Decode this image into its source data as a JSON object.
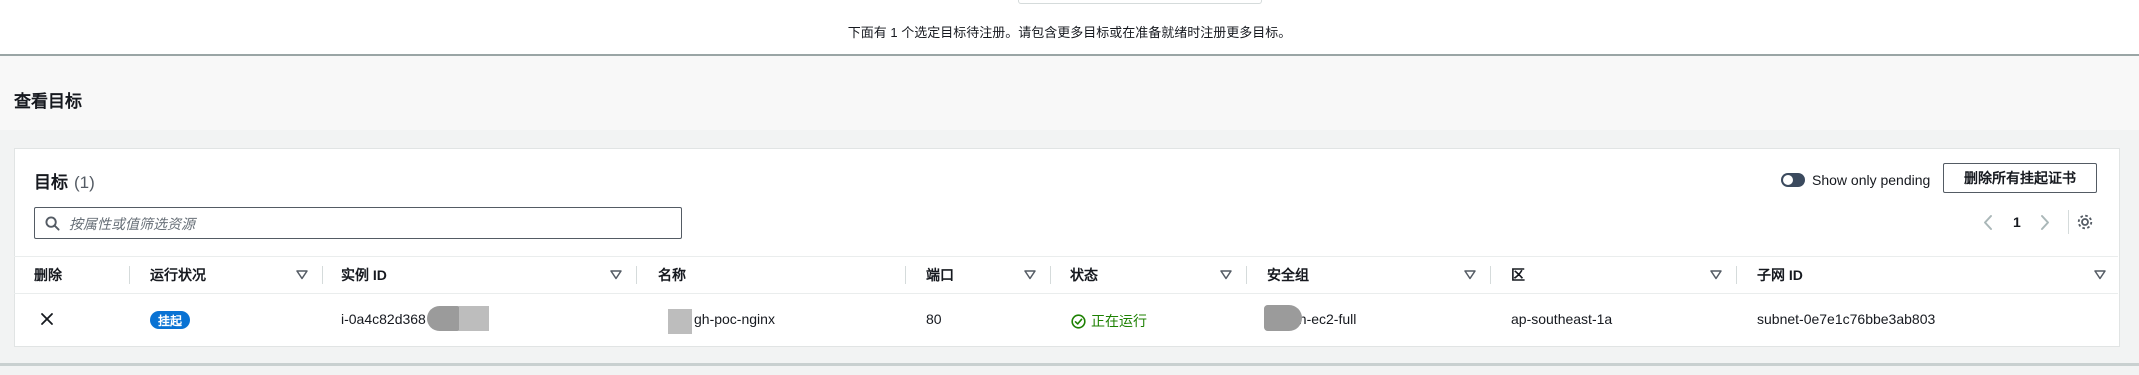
{
  "notice": "下面有 1 个选定目标待注册。请包含更多目标或在准备就绪时注册更多目标。",
  "view_targets": {
    "title": "查看目标"
  },
  "targets_panel": {
    "title": "目标",
    "count": "(1)",
    "toggle_label": "Show only pending",
    "remove_all_button": "删除所有挂起证书",
    "search_placeholder": "按属性或值筛选资源",
    "page_number": "1"
  },
  "table": {
    "headers": {
      "delete": "删除",
      "health": "运行状况",
      "instance_id": "实例 ID",
      "name": "名称",
      "port": "端口",
      "state": "状态",
      "security_group": "安全组",
      "zone": "区",
      "subnet_id": "子网 ID"
    },
    "rows": [
      {
        "health_badge": "挂起",
        "instance_id": "i-0a4c82d368",
        "name": "gh-poc-nginx",
        "port": "80",
        "state": "正在运行",
        "security_group": "gh-ec2-full",
        "zone": "ap-southeast-1a",
        "subnet_id": "subnet-0e7e1c76bbe3ab803"
      }
    ]
  },
  "colors": {
    "badge_bg": "#0972d3",
    "running_green": "#1d8102",
    "toggle_off": "#3b4a5e"
  },
  "icons": [
    "search-icon",
    "chevron-left-icon",
    "chevron-right-icon",
    "gear-icon",
    "close-icon",
    "check-circle-icon",
    "sort-caret-icon"
  ]
}
